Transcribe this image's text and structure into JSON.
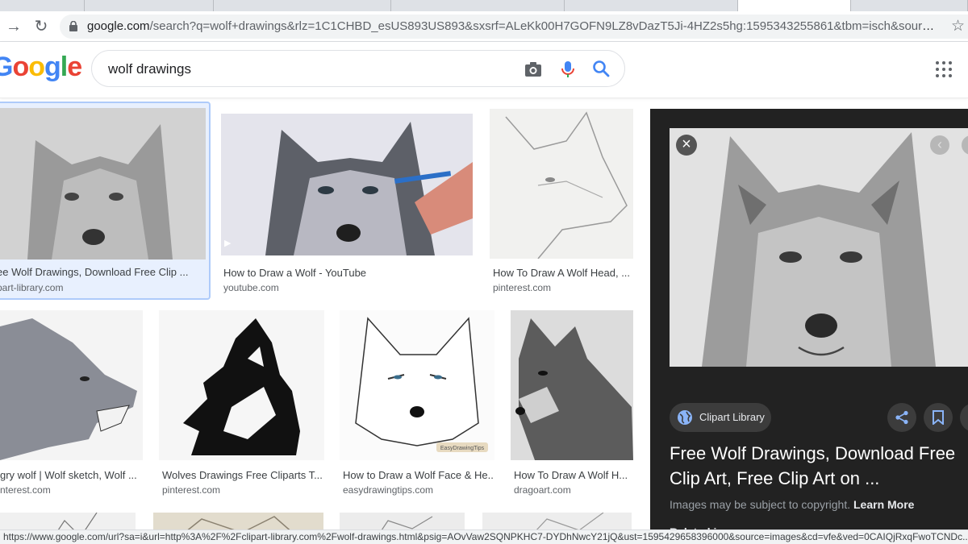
{
  "browser": {
    "url_host": "google.com",
    "url_rest": "/search?q=wolf+drawings&rlz=1C1CHBD_esUS893US893&sxsrf=ALeKk00H7GOFN9LZ8vDazT5Ji-4HZ2s5hg:1595343255861&tbm=isch&source=iu&ict...",
    "back_icon": "arrow-right-icon",
    "reload_icon": "reload-icon",
    "bookmark_icon": "star-icon"
  },
  "header": {
    "logo_text": "Google",
    "query": "wolf drawings",
    "camera_icon": "camera-icon",
    "mic_icon": "mic-icon",
    "search_icon": "search-icon",
    "apps_icon": "apps-grid-icon"
  },
  "results": [
    {
      "caption": "ee Wolf Drawings, Download Free Clip ...",
      "source": "part-library.com",
      "selected": true
    },
    {
      "caption": "How to Draw a Wolf - YouTube",
      "source": "youtube.com",
      "video": true
    },
    {
      "caption": "How To Draw A Wolf Head, ...",
      "source": "pinterest.com"
    },
    {
      "caption": "gry wolf | Wolf sketch, Wolf ...",
      "source": "nterest.com"
    },
    {
      "caption": "Wolves Drawings Free Cliparts T...",
      "source": "pinterest.com"
    },
    {
      "caption": "How to Draw a Wolf Face & He...",
      "source": "easydrawingtips.com",
      "watermark": "EasyDrawingTips"
    },
    {
      "caption": "How To Draw A Wolf H...",
      "source": "dragoart.com"
    }
  ],
  "panel": {
    "source_name": "Clipart Library",
    "title": "Free Wolf Drawings, Download Free Clip Art, Free Clip Art on ...",
    "copyright_text": "Images may be subject to copyright.",
    "learn_more": "Learn More",
    "related_label": "Related images",
    "close_icon": "close-icon",
    "share_icon": "share-icon",
    "save_icon": "bookmark-icon"
  },
  "status_url": "https://www.google.com/url?sa=i&url=http%3A%2F%2Fclipart-library.com%2Fwolf-drawings.html&psig=AOvVaw2SQNPKHC7-DYDhNwcY21jQ&ust=1595429658396000&source=images&cd=vfe&ved=0CAIQjRxqFwoTCNDc..."
}
